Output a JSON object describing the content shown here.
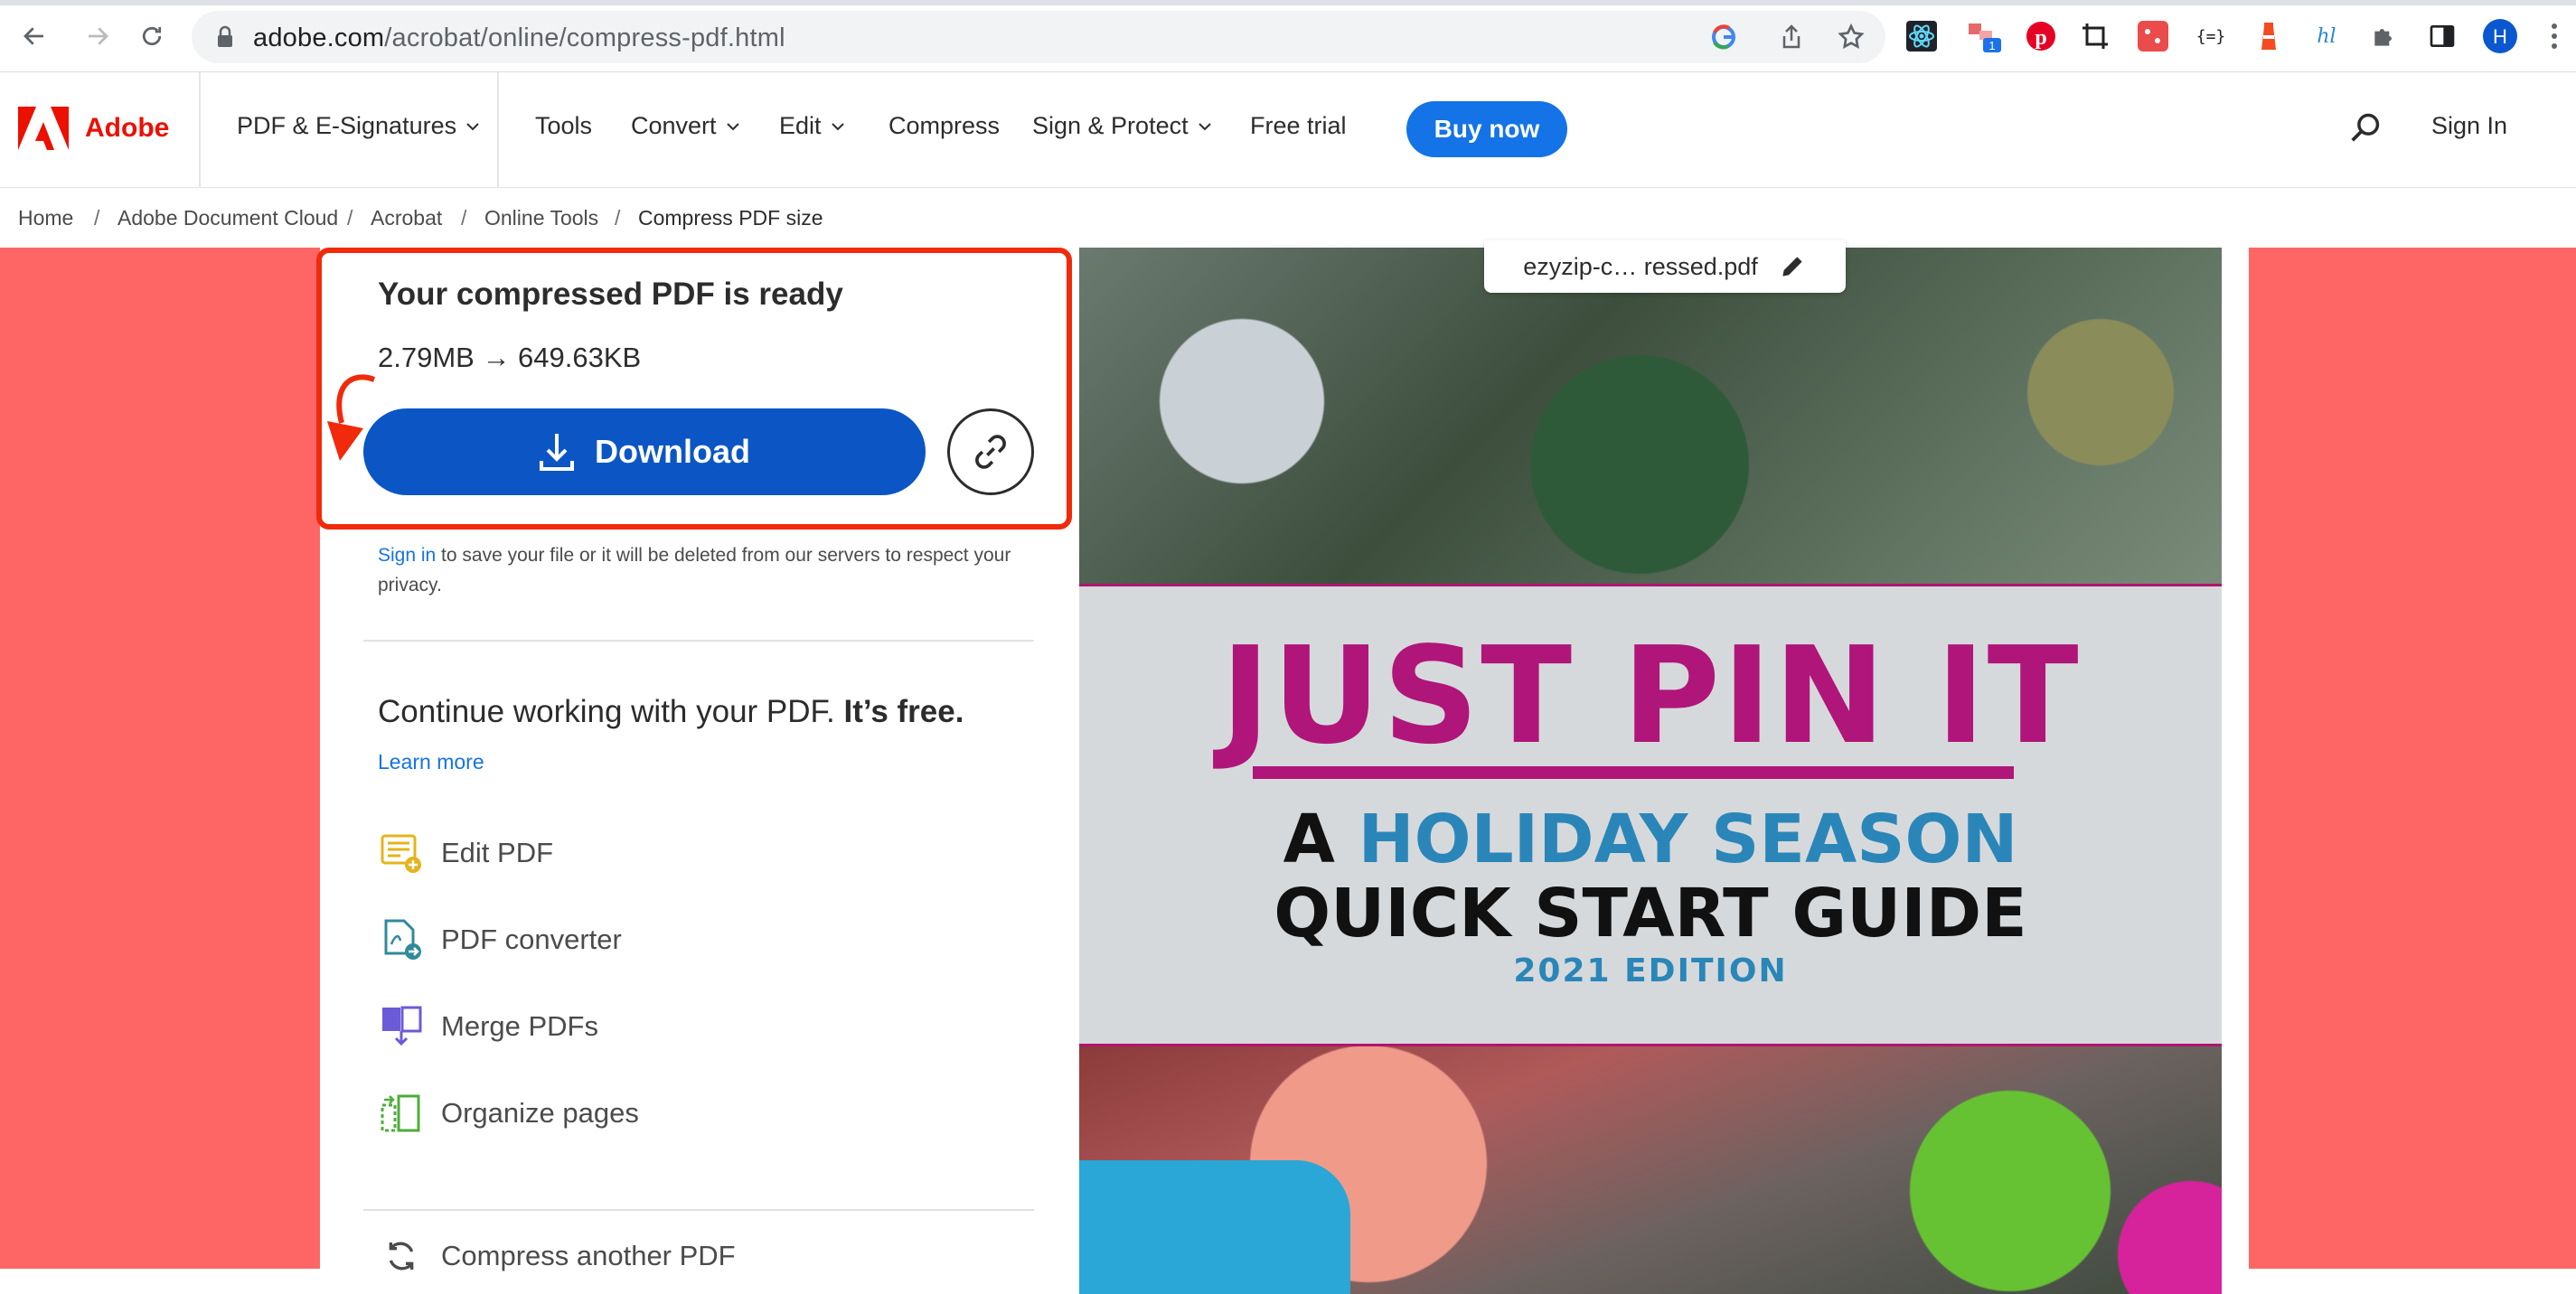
{
  "browser": {
    "url_host": "adobe.com",
    "url_path": "/acrobat/online/compress-pdf.html",
    "extension_badge": "1",
    "profile_initial": "H"
  },
  "header": {
    "brand": "Adobe",
    "nav": [
      "PDF & E-Signatures",
      "Tools",
      "Convert",
      "Edit",
      "Compress",
      "Sign & Protect",
      "Free trial"
    ],
    "buy_now": "Buy now",
    "sign_in": "Sign In"
  },
  "breadcrumb": [
    "Home",
    "Adobe Document Cloud",
    "Acrobat",
    "Online Tools",
    "Compress PDF size"
  ],
  "result": {
    "title": "Your compressed PDF is ready",
    "size_change": "2.79MB → 649.63KB",
    "download_label": "Download",
    "signin_link": "Sign in",
    "signin_note": " to save your file or it will be deleted from our servers to respect your privacy."
  },
  "continue": {
    "text": "Continue working with your PDF.",
    "bold": "It’s free.",
    "learn_more": "Learn more",
    "tools": [
      "Edit PDF",
      "PDF converter",
      "Merge PDFs",
      "Organize pages"
    ],
    "compress_another": "Compress another PDF"
  },
  "preview": {
    "file_name": "ezyzip-c… ressed.pdf",
    "cover_title": "JUST PIN IT",
    "cover_sub_a": "A ",
    "cover_sub_b": "HOLIDAY SEASON",
    "cover_sub_c": "QUICK START GUIDE",
    "cover_edition": "2021 EDITION"
  },
  "colors": {
    "stage": "#fe6666",
    "highlight": "#f02a0a",
    "download": "#0b56c4",
    "buy_now": "#1473e6",
    "adobe_red": "#eb1000",
    "cover_magenta": "#b0157a",
    "cover_teal": "#2a86b8"
  }
}
